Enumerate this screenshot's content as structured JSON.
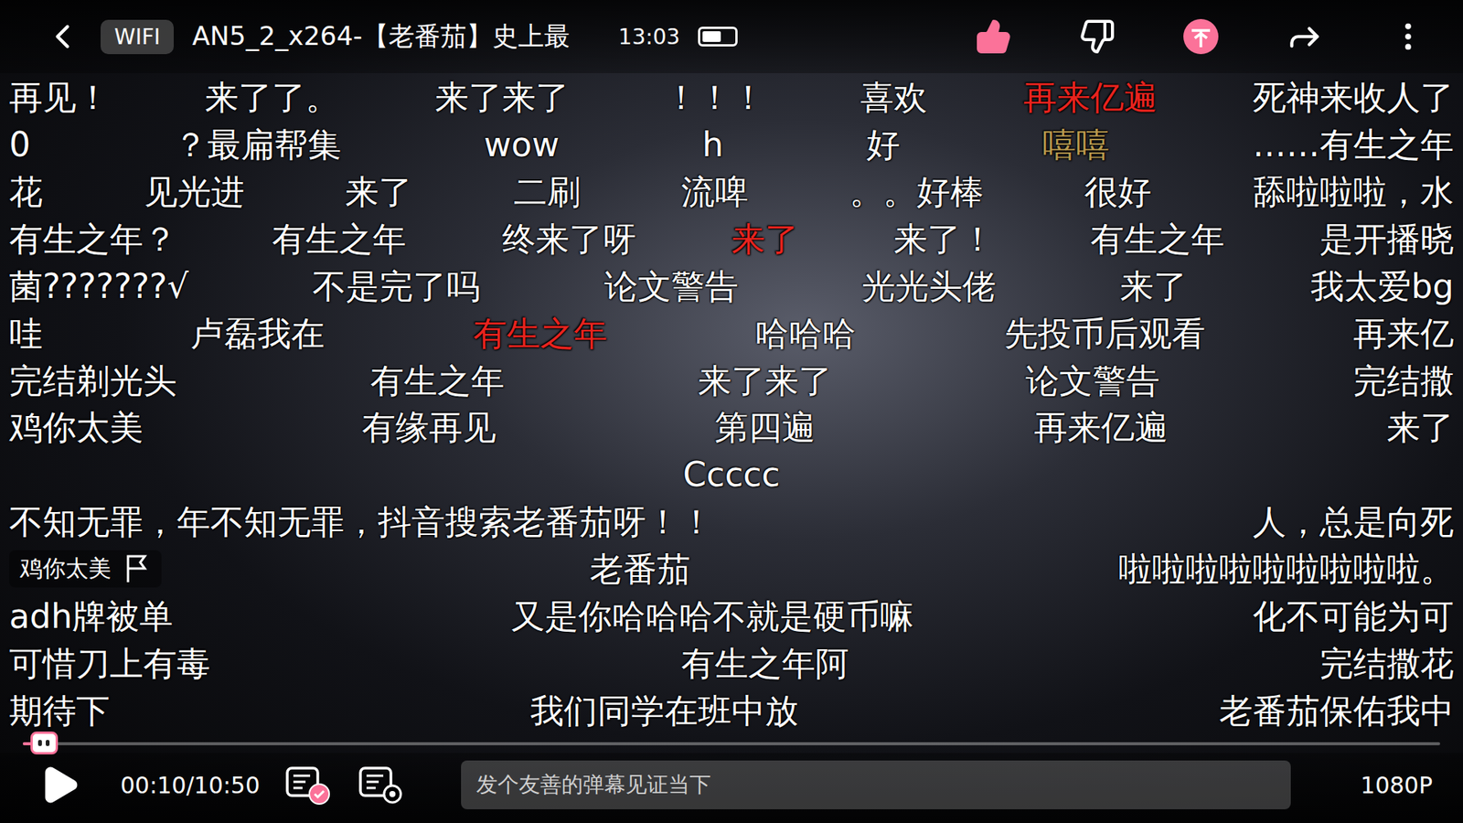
{
  "top_bar": {
    "network": "WIFI",
    "title": "AN5_2_x264-【老番茄】史上最",
    "time": "13:03",
    "battery": 0.6,
    "liked": true
  },
  "danmaku_rows": [
    {
      "items": [
        {
          "kind": "comment",
          "text": "再见！",
          "color": "#ffffff"
        },
        {
          "kind": "comment",
          "text": "来了了。",
          "color": "#ffffff"
        },
        {
          "kind": "comment",
          "text": "来了来了",
          "color": "#ffffff"
        },
        {
          "kind": "comment",
          "text": "！！！",
          "color": "#ffffff"
        },
        {
          "kind": "comment",
          "text": "喜欢",
          "color": "#ffffff"
        },
        {
          "kind": "comment",
          "text": "再来亿遍",
          "color": "#e8231e"
        },
        {
          "kind": "comment",
          "text": "死神来收人了",
          "color": "#ffffff"
        }
      ]
    },
    {
      "items": [
        {
          "kind": "comment",
          "text": "0",
          "color": "#ffffff"
        },
        {
          "kind": "comment",
          "text": "？最扁帮集",
          "color": "#ffffff"
        },
        {
          "kind": "comment",
          "text": "wow",
          "color": "#ffffff"
        },
        {
          "kind": "comment",
          "text": "h",
          "color": "#ffffff"
        },
        {
          "kind": "comment",
          "text": "好",
          "color": "#ffffff"
        },
        {
          "kind": "comment",
          "text": "嘻嘻",
          "color": "#b89a4f"
        },
        {
          "kind": "comment",
          "text": "……有生之年",
          "color": "#ffffff"
        }
      ]
    },
    {
      "items": [
        {
          "kind": "comment",
          "text": "花",
          "color": "#ffffff"
        },
        {
          "kind": "comment",
          "text": "见光进",
          "color": "#ffffff"
        },
        {
          "kind": "comment",
          "text": "来了",
          "color": "#ffffff"
        },
        {
          "kind": "comment",
          "text": "二刷",
          "color": "#ffffff"
        },
        {
          "kind": "comment",
          "text": "流啤",
          "color": "#ffffff"
        },
        {
          "kind": "comment",
          "text": "。。好棒",
          "color": "#ffffff"
        },
        {
          "kind": "comment",
          "text": "很好",
          "color": "#ffffff"
        },
        {
          "kind": "comment",
          "text": "舔啦啦啦，水",
          "color": "#ffffff"
        }
      ]
    },
    {
      "items": [
        {
          "kind": "comment",
          "text": "有生之年？",
          "color": "#ffffff"
        },
        {
          "kind": "comment",
          "text": "有生之年",
          "color": "#ffffff"
        },
        {
          "kind": "comment",
          "text": "终来了呀",
          "color": "#ffffff"
        },
        {
          "kind": "comment",
          "text": "来了",
          "color": "#e8231e"
        },
        {
          "kind": "comment",
          "text": "来了！",
          "color": "#ffffff"
        },
        {
          "kind": "comment",
          "text": "有生之年",
          "color": "#ffffff"
        },
        {
          "kind": "comment",
          "text": "是开播晓",
          "color": "#ffffff"
        }
      ]
    },
    {
      "items": [
        {
          "kind": "comment",
          "text": "菌???????√",
          "color": "#ffffff"
        },
        {
          "kind": "comment",
          "text": "不是完了吗",
          "color": "#ffffff"
        },
        {
          "kind": "comment",
          "text": "论文警告",
          "color": "#ffffff"
        },
        {
          "kind": "comment",
          "text": "光光头佬",
          "color": "#ffffff"
        },
        {
          "kind": "comment",
          "text": "来了",
          "color": "#ffffff"
        },
        {
          "kind": "comment",
          "text": "我太爱bg",
          "color": "#ffffff"
        }
      ]
    },
    {
      "items": [
        {
          "kind": "comment",
          "text": "哇",
          "color": "#ffffff"
        },
        {
          "kind": "comment",
          "text": "卢磊我在",
          "color": "#ffffff"
        },
        {
          "kind": "comment",
          "text": "有生之年",
          "color": "#e8231e"
        },
        {
          "kind": "comment",
          "text": "哈哈哈",
          "color": "#ffffff"
        },
        {
          "kind": "comment",
          "text": "先投币后观看",
          "color": "#ffffff"
        },
        {
          "kind": "comment",
          "text": "再来亿",
          "color": "#ffffff"
        }
      ]
    },
    {
      "items": [
        {
          "kind": "comment",
          "text": "完结剃光头",
          "color": "#ffffff"
        },
        {
          "kind": "comment",
          "text": "有生之年",
          "color": "#ffffff"
        },
        {
          "kind": "comment",
          "text": "来了来了",
          "color": "#ffffff"
        },
        {
          "kind": "comment",
          "text": "论文警告",
          "color": "#ffffff"
        },
        {
          "kind": "comment",
          "text": "完结撒",
          "color": "#ffffff"
        }
      ]
    },
    {
      "items": [
        {
          "kind": "comment",
          "text": "鸡你太美",
          "color": "#ffffff"
        },
        {
          "kind": "comment",
          "text": "有缘再见",
          "color": "#ffffff"
        },
        {
          "kind": "comment",
          "text": "第四遍",
          "color": "#ffffff"
        },
        {
          "kind": "comment",
          "text": "再来亿遍",
          "color": "#ffffff"
        },
        {
          "kind": "comment",
          "text": "来了",
          "color": "#ffffff"
        }
      ]
    },
    {
      "items": [
        {
          "kind": "comment",
          "text": "Ccccc",
          "color": "#ffffff"
        }
      ]
    },
    {
      "items": [
        {
          "kind": "comment",
          "text": "不知无罪，年不知无罪，抖音搜索老番茄呀！！",
          "color": "#ffffff"
        },
        {
          "kind": "comment",
          "text": "人，总是向死",
          "color": "#ffffff"
        }
      ]
    },
    {
      "items": [
        {
          "kind": "picked",
          "text": "鸡你太美",
          "color": "#ffffff"
        },
        {
          "kind": "comment",
          "text": "老番茄",
          "color": "#ffffff"
        },
        {
          "kind": "comment",
          "text": "啦啦啦啦啦啦啦啦啦。",
          "color": "#ffffff"
        }
      ]
    },
    {
      "items": [
        {
          "kind": "comment",
          "text": "adh牌被单",
          "color": "#ffffff"
        },
        {
          "kind": "comment",
          "text": "又是你哈哈哈不就是硬币嘛",
          "color": "#ffffff"
        },
        {
          "kind": "comment",
          "text": "化不可能为可",
          "color": "#ffffff"
        }
      ]
    },
    {
      "items": [
        {
          "kind": "comment",
          "text": "可惜刀上有毒",
          "color": "#ffffff"
        },
        {
          "kind": "comment",
          "text": "有生之年阿",
          "color": "#ffffff"
        },
        {
          "kind": "comment",
          "text": "完结撒花",
          "color": "#ffffff"
        }
      ]
    },
    {
      "items": [
        {
          "kind": "comment",
          "text": "期待下",
          "color": "#ffffff"
        },
        {
          "kind": "comment",
          "text": "我们同学在班中放",
          "color": "#ffffff"
        },
        {
          "kind": "comment",
          "text": "老番茄保佑我中",
          "color": "#ffffff"
        }
      ]
    }
  ],
  "player": {
    "playing": false,
    "position": "00:10/10:50",
    "progress": 0.015,
    "danmaku_on": true,
    "input_placeholder": "发个友善的弹幕见证当下",
    "quality": "1080P"
  }
}
